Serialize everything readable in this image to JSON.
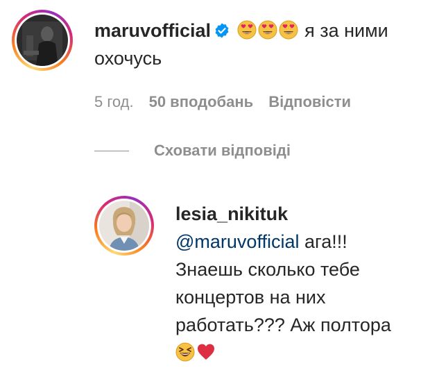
{
  "comment": {
    "username": "maruvofficial",
    "verified_icon": "verified-badge-icon",
    "emojis": [
      "heart-eyes-emoji",
      "heart-eyes-emoji",
      "heart-eyes-emoji"
    ],
    "text": " я за ними охочусь",
    "time": "5 год.",
    "likes": "50 вподобань",
    "reply_label": "Відповісти"
  },
  "replies_toggle": {
    "label": "Сховати відповіді"
  },
  "reply": {
    "username": "lesia_nikituk",
    "mention": "@maruvofficial",
    "text": " ага!!! Знаешь сколько тебе концертов на них работать??? Аж полтора",
    "emojis": [
      "grinning-squinting-emoji",
      "red-heart-emoji"
    ]
  },
  "colors": {
    "text": "#262626",
    "muted": "#8e8e8e",
    "mention": "#00376b",
    "verified": "#0095f6"
  }
}
